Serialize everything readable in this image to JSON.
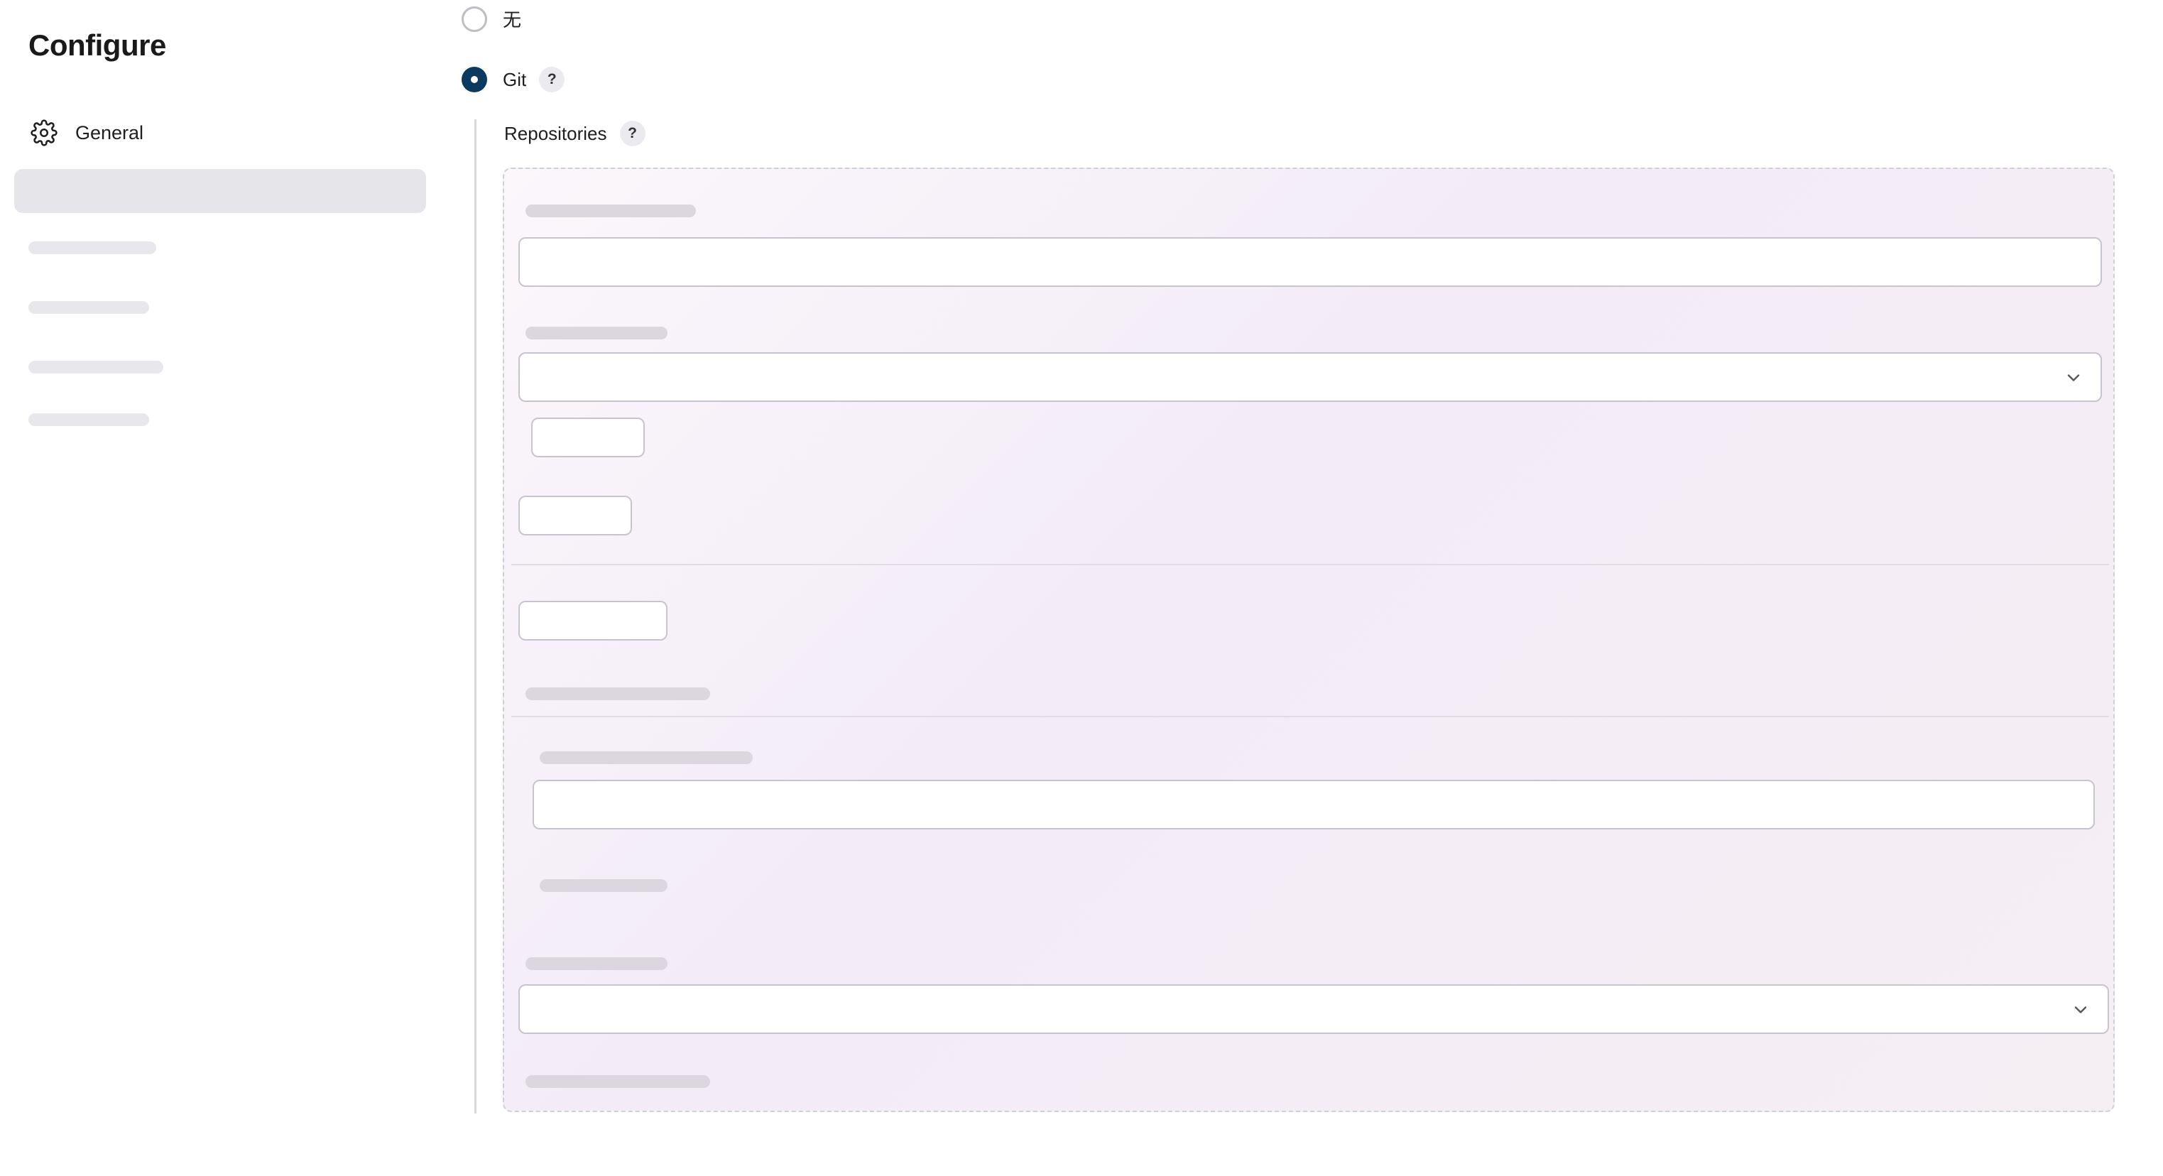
{
  "header": {
    "title": "Configure"
  },
  "sidebar": {
    "items": [
      {
        "label": "General",
        "icon": "gear-icon"
      }
    ]
  },
  "scm": {
    "options": [
      {
        "label": "无",
        "checked": false
      },
      {
        "label": "Git",
        "checked": true,
        "help": "?"
      }
    ],
    "repositories": {
      "label": "Repositories",
      "help": "?"
    }
  },
  "colors": {
    "accent": "#0b3a5e",
    "active_bg": "#e6e6ea"
  }
}
